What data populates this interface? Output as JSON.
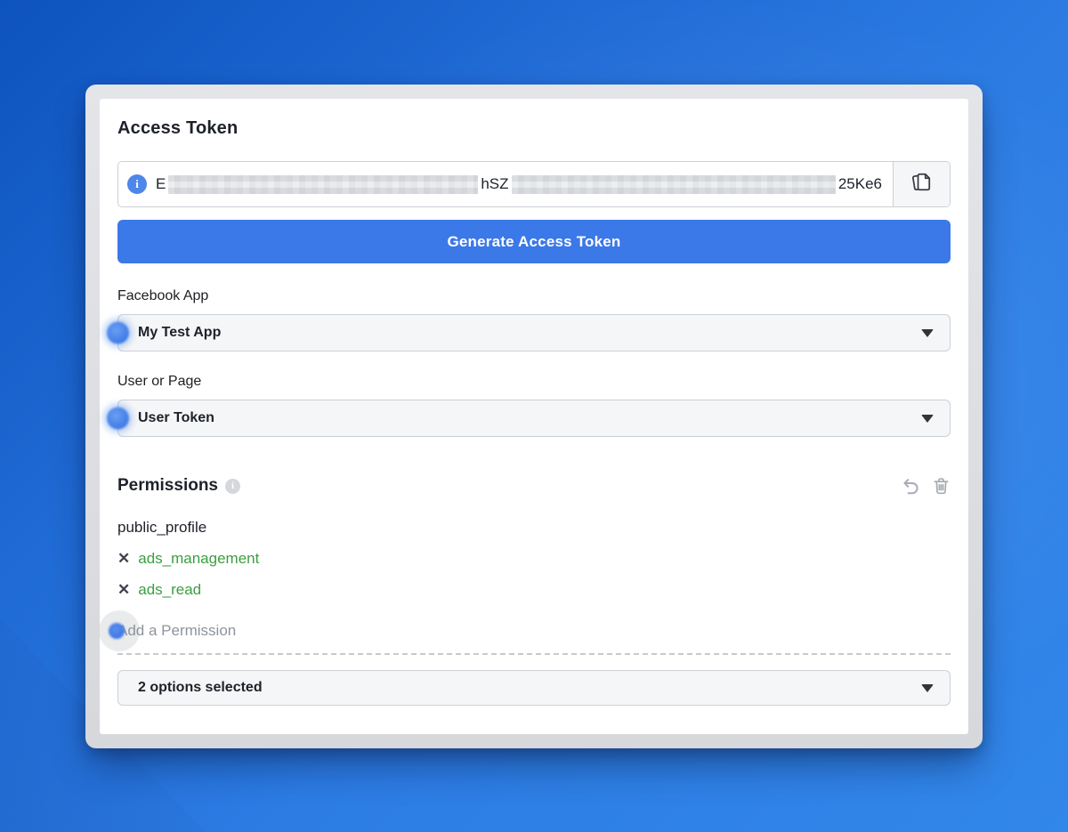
{
  "card": {
    "title": "Access Token"
  },
  "token_field": {
    "visible_start": "E",
    "visible_middle": "hSZ",
    "visible_end": "25Ke6"
  },
  "buttons": {
    "generate": "Generate Access Token"
  },
  "selectors": [
    {
      "label": "Facebook App",
      "value": "My Test App"
    },
    {
      "label": "User or Page",
      "value": "User Token"
    }
  ],
  "permissions": {
    "heading": "Permissions",
    "items": [
      {
        "name": "public_profile",
        "removable": false
      },
      {
        "name": "ads_management",
        "removable": true
      },
      {
        "name": "ads_read",
        "removable": true
      }
    ],
    "add_placeholder": "Add a Permission",
    "selected_summary": "2 options selected"
  },
  "icons": {
    "info_glyph": "i",
    "remove_glyph": "✕"
  },
  "colors": {
    "accent_blue": "#3b78e8",
    "link_green": "#3c9e41",
    "background_top_left": "#0e53be",
    "background_bottom_right": "#3287ea",
    "frame_gray": "#dcdee2"
  }
}
